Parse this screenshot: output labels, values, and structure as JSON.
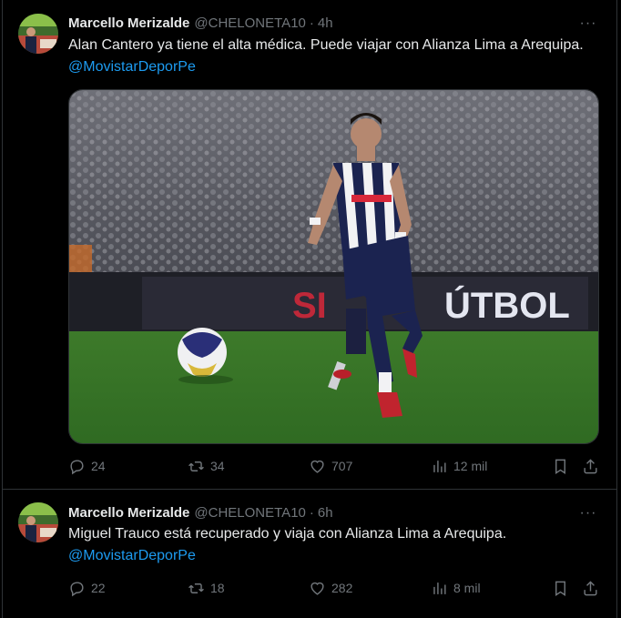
{
  "tweets": [
    {
      "author_name": "Marcello Merizalde",
      "handle": "@CHELONETA10",
      "separator": "·",
      "time": "4h",
      "more_label": "···",
      "text": "Alan Cantero ya tiene el alta médica. Puede viajar con Alianza Lima a Arequipa. ",
      "mention": "@MovistarDeporPe",
      "has_media": true,
      "stats": {
        "replies": "24",
        "retweets": "34",
        "likes": "707",
        "views": "12 mil"
      }
    },
    {
      "author_name": "Marcello Merizalde",
      "handle": "@CHELONETA10",
      "separator": "·",
      "time": "6h",
      "more_label": "···",
      "text": "Miguel Trauco está recuperado y viaja con Alianza Lima a Arequipa.",
      "mention": "@MovistarDeporPe",
      "has_media": false,
      "stats": {
        "replies": "22",
        "retweets": "18",
        "likes": "282",
        "views": "8 mil"
      }
    }
  ],
  "media": {
    "banner_text_left": "SI ",
    "banner_text_right": "ÚTBOL"
  },
  "colors": {
    "background": "#000000",
    "text": "#e7e9ea",
    "muted": "#71767b",
    "link": "#1d9bf0",
    "border": "#2f3336"
  },
  "icons": [
    "reply-icon",
    "retweet-icon",
    "like-icon",
    "views-icon",
    "bookmark-icon",
    "share-icon",
    "more-icon"
  ]
}
